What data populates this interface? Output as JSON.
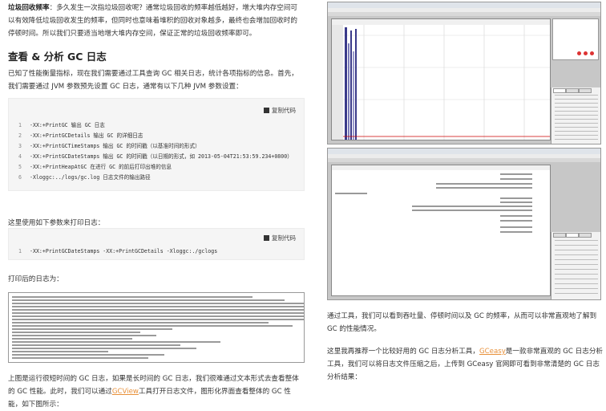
{
  "left": {
    "intro_label": "垃圾回收频率",
    "intro_text": "：多久发生一次指垃圾回收呢？通常垃圾回收的频率越低越好，增大堆内存空间可以有效降低垃圾回收发生的频率，但同时也意味着堆积的回收对象越多，最终也会增加回收时的停顿时间。所以我们只要适当地增大堆内存空间，保证正常的垃圾回收频率即可。",
    "heading": "查看 & 分析 GC 日志",
    "para2": "已知了性能衡量指标，现在我们需要通过工具查询 GC 相关日志，统计各项指标的信息。首先，我们需要通过 JVM 参数预先设置 GC 日志，通常有以下几种 JVM 参数设置：",
    "copy_label": "复制代码",
    "code1": [
      {
        "n": "1",
        "text": "-XX:+PrintGC 输出 GC 日志"
      },
      {
        "n": "2",
        "text": "-XX:+PrintGCDetails 输出 GC 的详细日志"
      },
      {
        "n": "3",
        "text": "-XX:+PrintGCTimeStamps 输出 GC 的时间戳（以基准时间的形式）"
      },
      {
        "n": "4",
        "text": "-XX:+PrintGCDateStamps 输出 GC 的时间戳（以日期的形式，如 2013-05-04T21:53:59.234+0800）"
      },
      {
        "n": "5",
        "text": "-XX:+PrintHeapAtGC 在进行 GC 的前后打印出堆的信息"
      },
      {
        "n": "6",
        "text": "-Xloggc:../logs/gc.log 日志文件的输出路径"
      }
    ],
    "para3": "这里使用如下参数来打印日志：",
    "code2": [
      {
        "n": "1",
        "text": "-XX:+PrintGCDateStamps -XX:+PrintGCDetails -Xloggc:./gclogs"
      }
    ],
    "para4": "打印后的日志为：",
    "para5_a": "上图是运行很短时间的 GC 日志，如果是长时间的 GC 日志，我们很难通过文本形式去查看整体的 GC 性能。此时，我们可以通过",
    "para5_link": "GCView",
    "para5_b": "工具打开日志文件，图形化界面查看整体的 GC 性能，如下图所示："
  },
  "right": {
    "para1": "通过工具，我们可以看到吞吐量、停顿时间以及 GC 的频率，从而可以非常直观地了解到 GC 的性能情况。",
    "para2_a": "这里我再推荐一个比较好用的 GC 日志分析工具，",
    "para2_link": "GCeasy",
    "para2_b": "是一款非常直观的 GC 日志分析工具，我们可以将日志文件压缩之后，上传到 GCeasy 官网即可看到非常清楚的 GC 日志分析结果："
  }
}
